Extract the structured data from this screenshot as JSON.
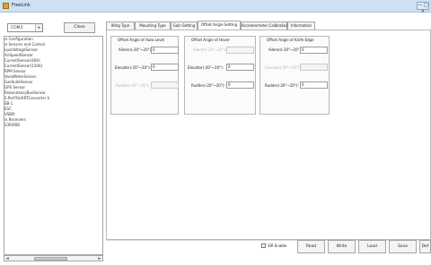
{
  "window": {
    "title": "FreeLink",
    "control": "— □ ×"
  },
  "connection": {
    "port": "COM3",
    "arrow": "▾",
    "close_label": "Close"
  },
  "tree": {
    "items": [
      "⊟ Configuration",
      "  ⊟ Sensors and Control",
      "      LipoVoltageSensor",
      "      AirSpeedSensor",
      "      CurrentSensor(40A)",
      "      CurrentSensor(150A)",
      "      RPM Sensor",
      "      VarioMeterSensor",
      "      GasSuiteSensor",
      "      GPS Sensor",
      "      RedundancyBusSensor",
      "      S.PortToUARTConverter S",
      "      SB-1",
      "      ESC",
      "      VSBIII",
      "  ⊟ Receivers",
      "      S3R/R8S"
    ],
    "scroll_left": "◄",
    "scroll_right": "►"
  },
  "tabs": [
    "Wing Type",
    "Mounting Type",
    "Gain Setting",
    "Offset Angle Setting",
    "Accelerometer Calibration",
    "Information"
  ],
  "groups": [
    {
      "title": "Offset Angle of Auto Level",
      "rows": [
        {
          "label": "Aileron(-20°~20°):",
          "value": "0",
          "disabled": false
        },
        {
          "label": "Elevator(-20°~20°):",
          "value": "0",
          "disabled": false
        },
        {
          "label": "Rudder(-20°~20°):",
          "value": "",
          "disabled": true
        }
      ]
    },
    {
      "title": "Offset Angle of Hover",
      "rows": [
        {
          "label": "Aileron(-20°~20°):",
          "value": "",
          "disabled": true
        },
        {
          "label": "Elevator(-20°~20°):",
          "value": "0",
          "disabled": false
        },
        {
          "label": "Rudder(-20°~20°):",
          "value": "0",
          "disabled": false
        }
      ]
    },
    {
      "title": "Offset Angle of Knife Edge",
      "rows": [
        {
          "label": "Aileron(-20°~20°):",
          "value": "0",
          "disabled": false
        },
        {
          "label": "Elevator(-20°~20°):",
          "value": "",
          "disabled": true
        },
        {
          "label": "Rudder(-20°~20°):",
          "value": "0",
          "disabled": false
        }
      ]
    }
  ],
  "footer": {
    "sir_label": "SIR Enable",
    "buttons": [
      "Read",
      "Write",
      "Load",
      "Save",
      "Def"
    ]
  }
}
